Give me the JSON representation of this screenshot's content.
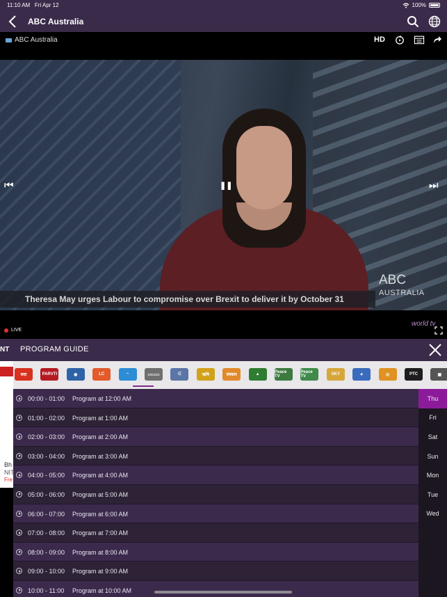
{
  "status_bar": {
    "time": "11:10 AM",
    "date": "Fri Apr 12",
    "battery": "100%"
  },
  "header": {
    "back_icon": "chevron-left-icon",
    "title": "ABC Australia",
    "search_icon": "search-icon",
    "globe_icon": "globe-icon"
  },
  "player": {
    "channel_label": "ABC Australia",
    "quality": "HD",
    "ticker": "Theresa May urges Labour to compromise over Brexit to deliver it by October 31",
    "logo_line1": "ABC",
    "logo_line2": "AUSTRALIA",
    "prev_icon": "⏮",
    "pause_icon": "❚❚",
    "next_icon": "⏭",
    "live_label": "LIVE",
    "brand": "world tv"
  },
  "guide": {
    "left_fragment": "NT",
    "title": "PROGRAM GUIDE",
    "close_icon": "close-icon",
    "channel_logos": [
      {
        "label": "सदा",
        "color": "#d8311f"
      },
      {
        "label": "PARVTI",
        "color": "#b51a22"
      },
      {
        "label": "◉",
        "color": "#2f63a8"
      },
      {
        "label": "LC",
        "color": "#e35a2b"
      },
      {
        "label": "~",
        "color": "#2d8cd6"
      },
      {
        "label": "▭▭▭",
        "color": "#6f6f6f"
      },
      {
        "label": "ᕮ",
        "color": "#5b76a6"
      },
      {
        "label": "ऋषि",
        "color": "#d2a11a"
      },
      {
        "label": "संस्कार",
        "color": "#e2892b"
      },
      {
        "label": "▲",
        "color": "#2e7d32"
      },
      {
        "label": "Peace TV",
        "color": "#3d7a3f"
      },
      {
        "label": "Peace TV",
        "color": "#3f8a4a"
      },
      {
        "label": "SKY",
        "color": "#d7a63a"
      },
      {
        "label": "✦",
        "color": "#3a6bbd"
      },
      {
        "label": "◎",
        "color": "#e09222"
      },
      {
        "label": "PTC",
        "color": "#1d1d1d"
      },
      {
        "label": "▣",
        "color": "#555555"
      }
    ],
    "programs": [
      {
        "time": "00:00 - 01:00",
        "title": "Program at 12:00 AM"
      },
      {
        "time": "01:00 - 02:00",
        "title": "Program at 1:00 AM"
      },
      {
        "time": "02:00 - 03:00",
        "title": "Program at 2:00 AM"
      },
      {
        "time": "03:00 - 04:00",
        "title": "Program at 3:00 AM"
      },
      {
        "time": "04:00 - 05:00",
        "title": "Program at 4:00 AM"
      },
      {
        "time": "05:00 - 06:00",
        "title": "Program at 5:00 AM"
      },
      {
        "time": "06:00 - 07:00",
        "title": "Program at 6:00 AM"
      },
      {
        "time": "07:00 - 08:00",
        "title": "Program at 7:00 AM"
      },
      {
        "time": "08:00 - 09:00",
        "title": "Program at 8:00 AM"
      },
      {
        "time": "09:00 - 10:00",
        "title": "Program at 9:00 AM"
      },
      {
        "time": "10:00 - 11:00",
        "title": "Program at 10:00 AM"
      }
    ],
    "days": [
      "Thu",
      "Fri",
      "Sat",
      "Sun",
      "Mon",
      "Tue",
      "Wed"
    ],
    "active_day": "Thu"
  },
  "side_ad": {
    "line1": "Bh",
    "line2": "NIT",
    "line3": "Fre"
  },
  "colors": {
    "accent": "#8c1b9a",
    "bar": "#3a2b4a"
  }
}
